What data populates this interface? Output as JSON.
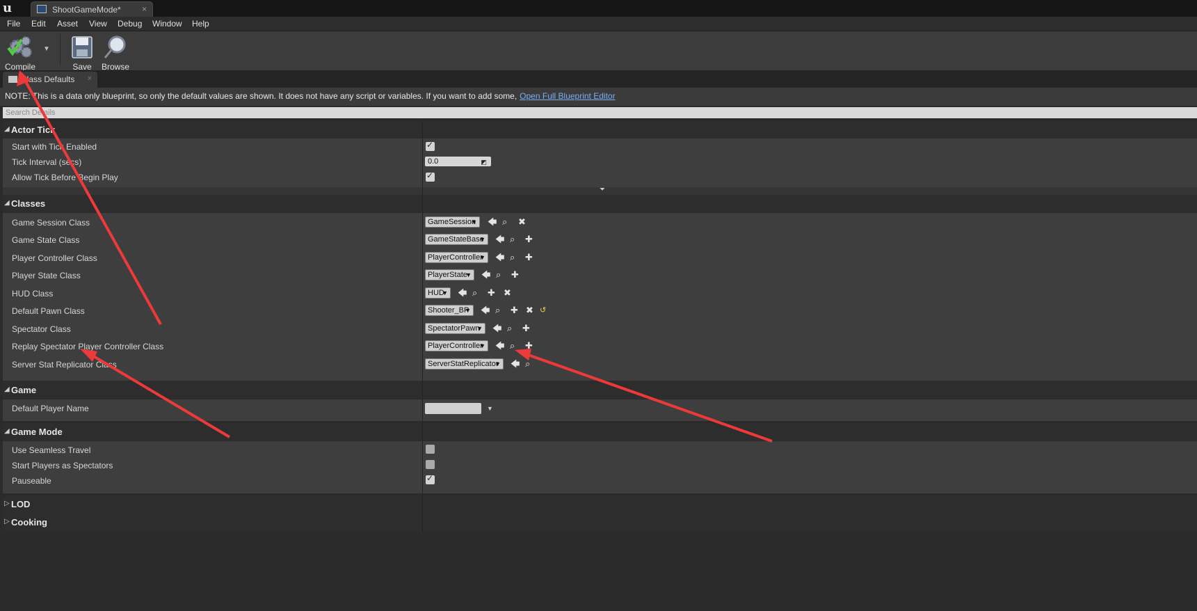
{
  "window": {
    "tab_title": "ShootGameMode*",
    "tab_close": "×"
  },
  "menu": [
    "File",
    "Edit",
    "Asset",
    "View",
    "Debug",
    "Window",
    "Help"
  ],
  "toolbar": {
    "compile_label": "Compile",
    "save_label": "Save",
    "browse_label": "Browse"
  },
  "panel": {
    "tab_label": "Class Defaults",
    "tab_close": "×"
  },
  "note": {
    "text": "NOTE: This is a data only blueprint, so only the default values are shown.  It does not have any script or variables.  If you want to add some,",
    "link": "Open Full Blueprint Editor"
  },
  "search": {
    "placeholder": "Search Details"
  },
  "categories": {
    "actor_tick": {
      "label": "Actor Tick",
      "start_with_tick_enabled": {
        "label": "Start with Tick Enabled",
        "checked": true
      },
      "tick_interval": {
        "label": "Tick Interval (secs)",
        "value": "0.0"
      },
      "allow_tick_before_begin_play": {
        "label": "Allow Tick Before Begin Play",
        "checked": true
      }
    },
    "classes": {
      "label": "Classes",
      "rows": [
        {
          "label": "Game Session Class",
          "value": "GameSession"
        },
        {
          "label": "Game State Class",
          "value": "GameStateBase"
        },
        {
          "label": "Player Controller Class",
          "value": "PlayerController"
        },
        {
          "label": "Player State Class",
          "value": "PlayerState"
        },
        {
          "label": "HUD Class",
          "value": "HUD"
        },
        {
          "label": "Default Pawn Class",
          "value": "Shooter_BP"
        },
        {
          "label": "Spectator Class",
          "value": "SpectatorPawn"
        },
        {
          "label": "Replay Spectator Player Controller Class",
          "value": "PlayerController"
        },
        {
          "label": "Server Stat Replicator Class",
          "value": "ServerStatReplicator"
        }
      ]
    },
    "game": {
      "label": "Game",
      "default_player_name": {
        "label": "Default Player Name",
        "value": ""
      }
    },
    "game_mode": {
      "label": "Game Mode",
      "use_seamless_travel": {
        "label": "Use Seamless Travel",
        "checked": false
      },
      "start_players_as_spectators": {
        "label": "Start Players as Spectators",
        "checked": false
      },
      "pauseable": {
        "label": "Pauseable",
        "checked": true
      }
    },
    "lod": {
      "label": "LOD"
    },
    "cooking": {
      "label": "Cooking"
    }
  },
  "icons": {
    "ue_logo": "unreal-logo-icon",
    "compile": "gears-check-icon",
    "save": "floppy-disk-icon",
    "browse": "magnifier-icon",
    "use_selected": "arrow-left-icon",
    "browse_asset": "search-icon",
    "new": "plus-icon",
    "clear": "close-icon",
    "reset": "reset-arrow-icon"
  },
  "colors": {
    "accent_link": "#7aaef5",
    "annotation_arrow": "#ec3a3a",
    "reset_icon": "#e8d44d"
  }
}
